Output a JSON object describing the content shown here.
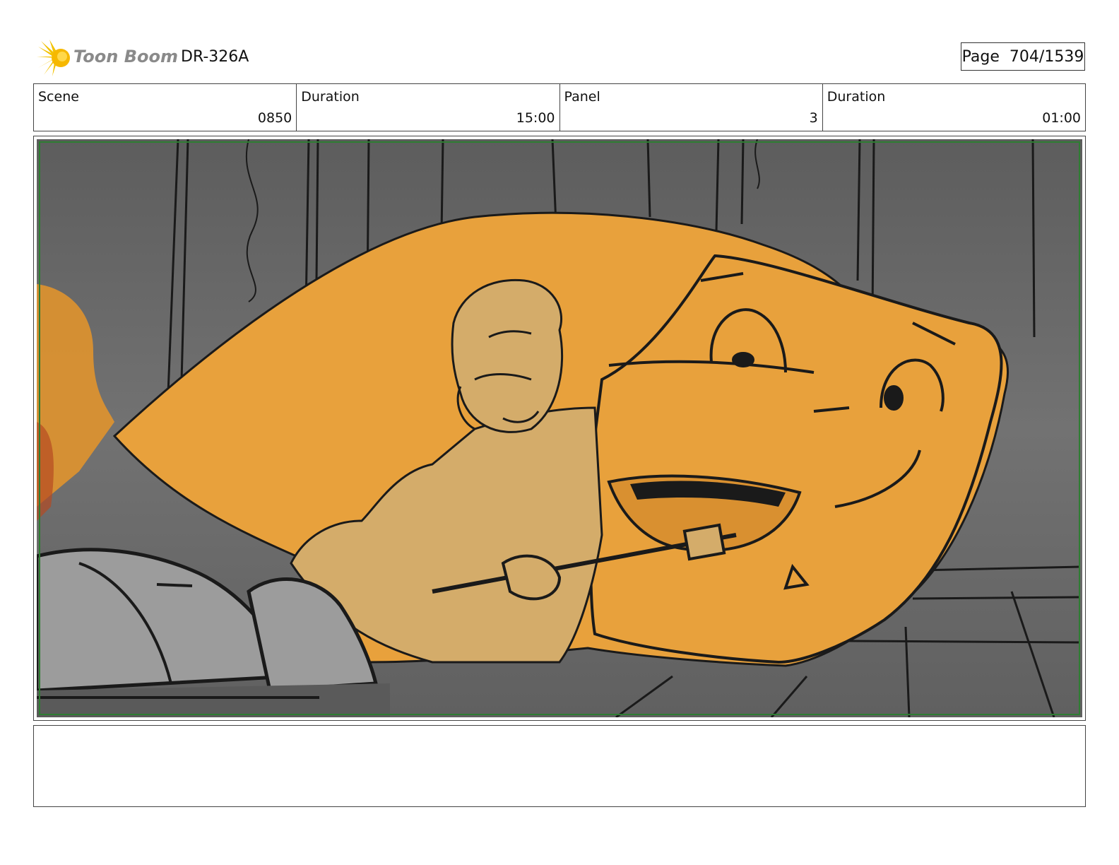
{
  "header": {
    "brand": "Toon Boom",
    "code": "DR-326A",
    "page_label": "Page",
    "page_value": "704/1539"
  },
  "info": [
    {
      "label": "Scene",
      "value": "0850"
    },
    {
      "label": "Duration",
      "value": "15:00"
    },
    {
      "label": "Panel",
      "value": "3"
    },
    {
      "label": "Duration",
      "value": "01:00"
    }
  ],
  "colors": {
    "background": "#6a6a6a",
    "dragon": "#e8a13c",
    "character": "#d4ac6a",
    "machine": "#9c9c9c",
    "safe_frame": "#2e7d32",
    "logo_flare": "#f2c200"
  },
  "icons": [
    "toon-boom-logo-icon"
  ]
}
